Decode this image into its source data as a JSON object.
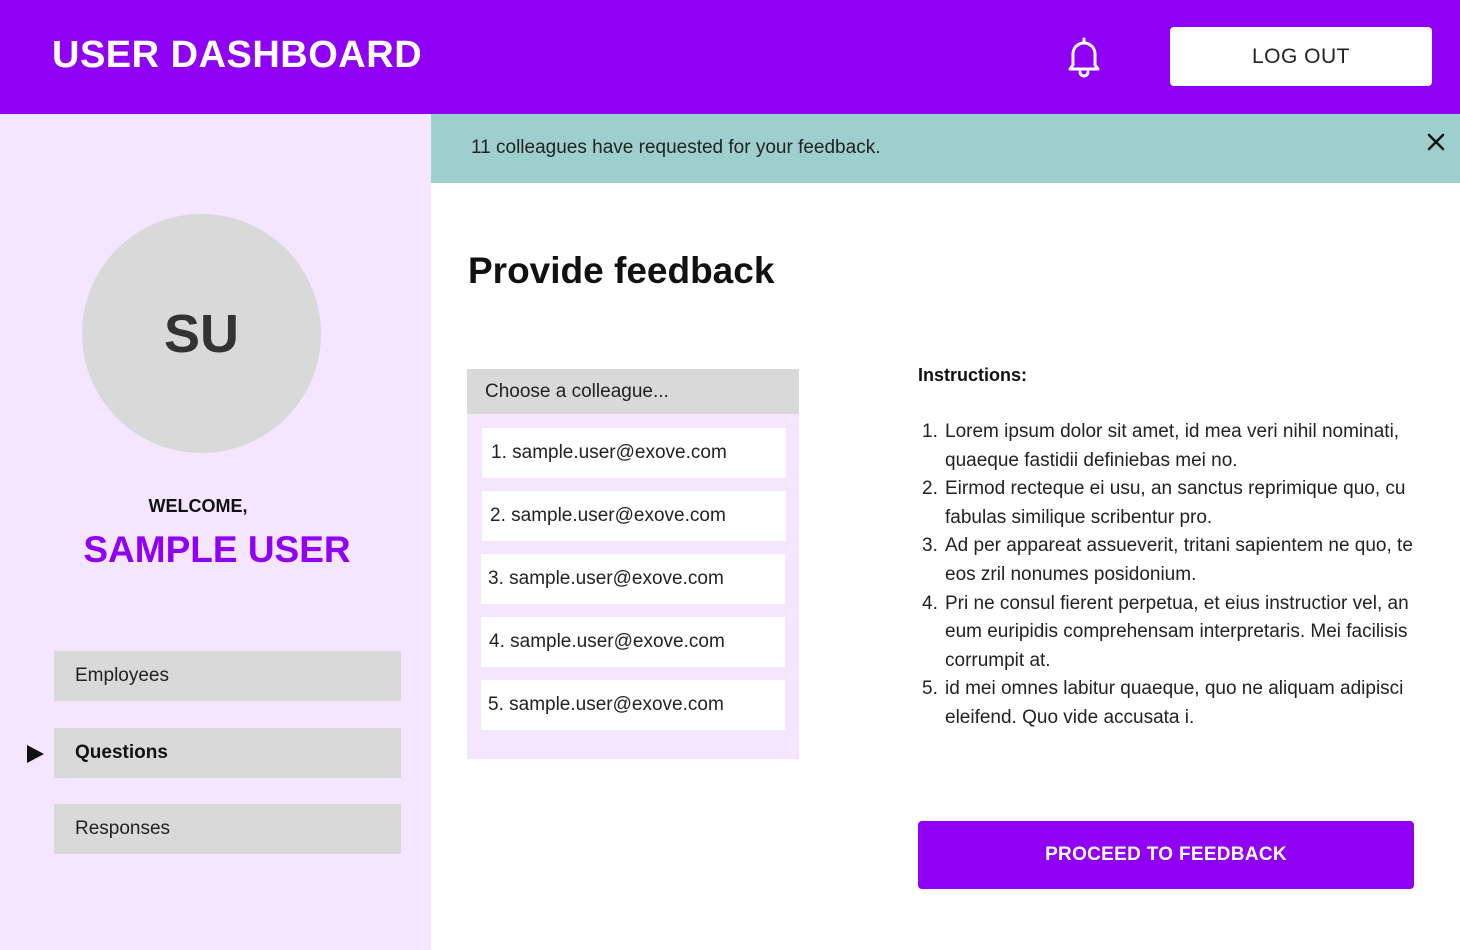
{
  "header": {
    "title": "USER DASHBOARD",
    "bell_icon": "bell-icon",
    "logout_label": "LOG OUT",
    "background_color": "#8f00f5"
  },
  "banner": {
    "message": "11 colleagues have requested for your feedback.",
    "close_icon": "close-icon",
    "background_color": "#9dcfcd"
  },
  "sidebar": {
    "avatar_initials": "SU",
    "welcome_label": "WELCOME,",
    "user_name": "SAMPLE USER",
    "background_color": "#f4e6ff",
    "nav_items": [
      {
        "label": "Employees",
        "active": false
      },
      {
        "label": "Questions",
        "active": true
      },
      {
        "label": "Responses",
        "active": false
      }
    ]
  },
  "main": {
    "title": "Provide feedback",
    "colleague_select": {
      "placeholder": "Choose a colleague...",
      "options": [
        "1. sample.user@exove.com",
        "2. sample.user@exove.com",
        "3. sample.user@exove.com",
        "4. sample.user@exove.com",
        "5. sample.user@exove.com"
      ]
    },
    "instructions": {
      "title": "Instructions:",
      "items": [
        {
          "num": "1.",
          "text": "Lorem ipsum dolor sit amet, id mea veri nihil nominati, quaeque fastidii definiebas mei no."
        },
        {
          "num": "2.",
          "text": "Eirmod recteque ei usu, an sanctus reprimique quo, cu fabulas similique scribentur pro."
        },
        {
          "num": "3.",
          "text": "Ad per appareat assueverit, tritani sapientem ne quo, te eos zril nonumes posidonium."
        },
        {
          "num": "4.",
          "text": "Pri ne consul fierent perpetua, et eius instructior vel, an eum euripidis comprehensam interpretaris. Mei facilisis corrumpit at."
        },
        {
          "num": "5.",
          "text": "id mei omnes labitur quaeque, quo ne aliquam adipisci eleifend. Quo vide accusata i."
        }
      ]
    },
    "proceed_label": "PROCEED TO FEEDBACK",
    "accent_color": "#8f00f5"
  }
}
